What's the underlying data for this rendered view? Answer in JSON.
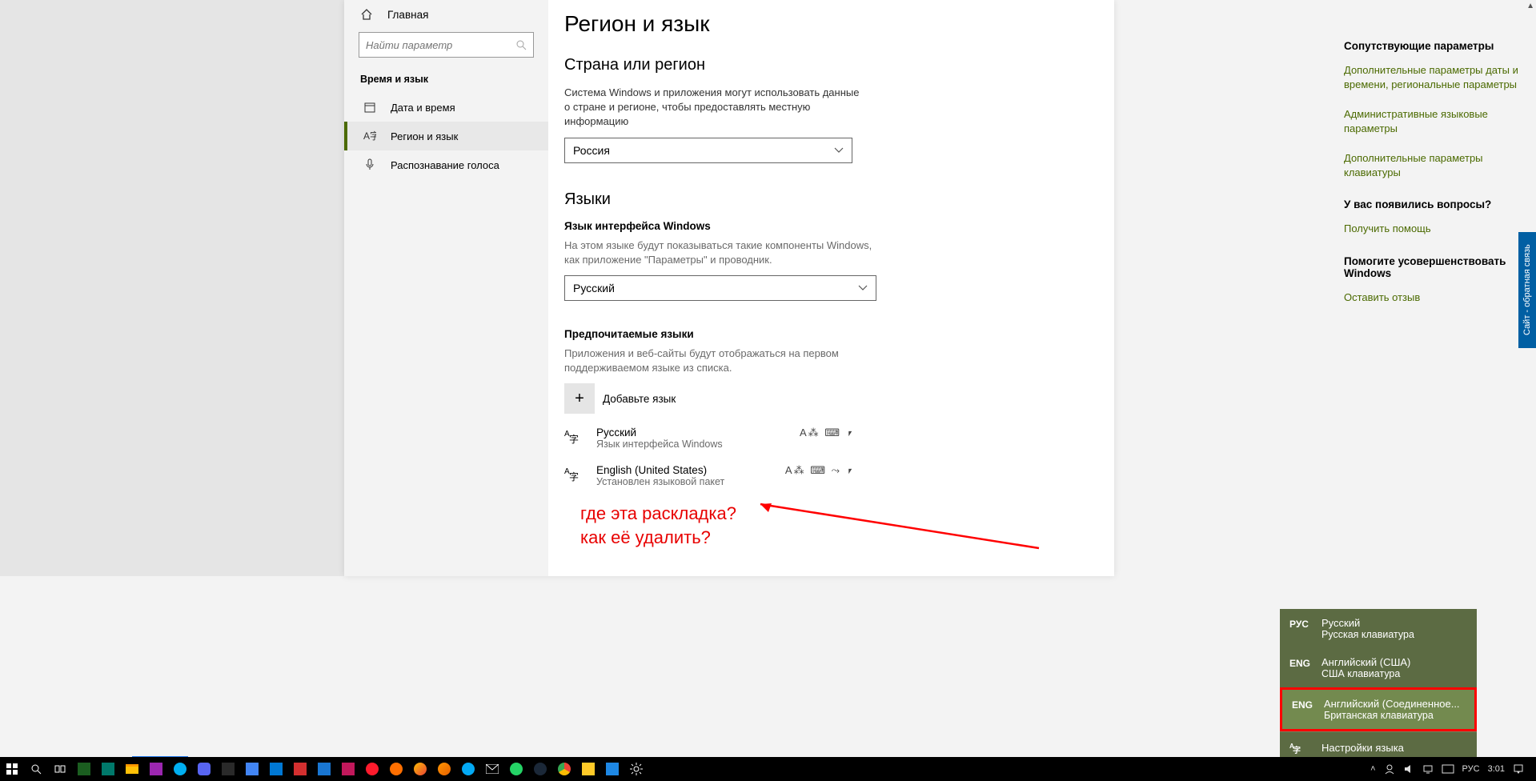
{
  "sidebar": {
    "home": "Главная",
    "search_placeholder": "Найти параметр",
    "section": "Время и язык",
    "items": [
      {
        "label": "Дата и время"
      },
      {
        "label": "Регион и язык"
      },
      {
        "label": "Распознавание голоса"
      }
    ]
  },
  "page": {
    "title": "Регион и язык",
    "region_h": "Страна или регион",
    "region_p": "Система Windows и приложения могут использовать данные о стране и регионе, чтобы предоставлять местную информацию",
    "region_value": "Россия",
    "langs_h": "Языки",
    "ui_lang_h": "Язык интерфейса Windows",
    "ui_lang_p": "На этом языке будут показываться такие компоненты Windows, как приложение \"Параметры\" и проводник.",
    "ui_lang_value": "Русский",
    "pref_h": "Предпочитаемые языки",
    "pref_p": "Приложения и веб-сайты будут отображаться на первом поддерживаемом языке из списка.",
    "add_lang": "Добавьте язык",
    "lang_cards": [
      {
        "name": "Русский",
        "sub": "Язык интерфейса Windows",
        "badges": "A⁂ ⌨ ⎖"
      },
      {
        "name": "English (United States)",
        "sub": "Установлен языковой пакет",
        "badges": "A⁂ ⌨ ⤳ ⎖"
      }
    ],
    "annotation_1": "где эта раскладка?",
    "annotation_2": "как её удалить?"
  },
  "rail": {
    "head1": "Сопутствующие параметры",
    "link1": "Дополнительные параметры даты и времени, региональные параметры",
    "link2": "Административные языковые параметры",
    "link3": "Дополнительные параметры клавиатуры",
    "head2": "У вас появились вопросы?",
    "link4": "Получить помощь",
    "head3": "Помогите усовершенствовать Windows",
    "link5": "Оставить отзыв"
  },
  "popup": {
    "rows": [
      {
        "code": "РУС",
        "t1": "Русский",
        "t2": "Русская клавиатура"
      },
      {
        "code": "ENG",
        "t1": "Английский (США)",
        "t2": "США клавиатура"
      },
      {
        "code": "ENG",
        "t1": "Английский (Соединенное...",
        "t2": "Британская клавиатура"
      }
    ],
    "settings": "Настройки языка"
  },
  "feedback": "Сайт - обратная связь",
  "tray": {
    "lang": "РУС",
    "time": "3:01"
  }
}
